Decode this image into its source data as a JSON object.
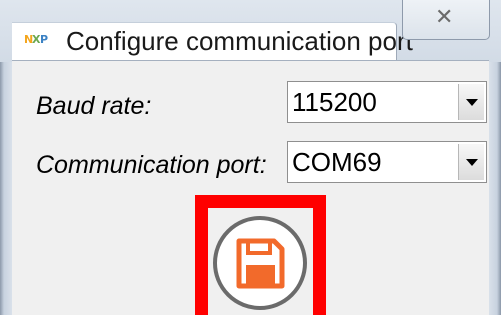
{
  "window": {
    "title": "Configure communication port",
    "close_glyph": "✕"
  },
  "icons": {
    "app_icon": "nxp-logo-icon",
    "close": "close-icon",
    "save": "floppy-disk-icon",
    "combo_arrow": "chevron-down-icon"
  },
  "form": {
    "baud_rate": {
      "label": "Baud rate:",
      "value": "115200"
    },
    "communication_port": {
      "label": "Communication port:",
      "value": "COM69"
    }
  },
  "colors": {
    "highlight": "#ff0000",
    "save_icon": "#f26a2b",
    "save_ring": "#6b6b6b"
  }
}
